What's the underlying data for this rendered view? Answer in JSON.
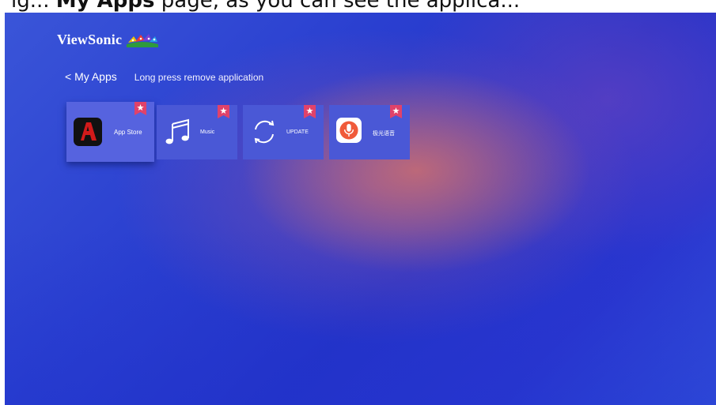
{
  "caption": {
    "before": "ig... ",
    "bold": "My Apps",
    "after": " page, as you can see the applica..."
  },
  "brand": {
    "name": "ViewSonic",
    "icon": "viewsonic-birds-logo"
  },
  "nav": {
    "back_label": "< My Apps",
    "hint": "Long press remove application"
  },
  "apps": [
    {
      "label": "App Store",
      "icon": "app-store-icon",
      "favorite": true,
      "focused": true
    },
    {
      "label": "Music",
      "icon": "music-note-icon",
      "favorite": true,
      "focused": false
    },
    {
      "label": "UPDATE",
      "icon": "update-sync-icon",
      "favorite": true,
      "focused": false
    },
    {
      "label": "极光语音",
      "icon": "voice-mic-icon",
      "favorite": true,
      "focused": false
    }
  ],
  "colors": {
    "tile": "#4a58d6",
    "badge": "#e0426a",
    "app_store_accent": "#d11a1a",
    "voice_accent": "#f05a3a"
  }
}
